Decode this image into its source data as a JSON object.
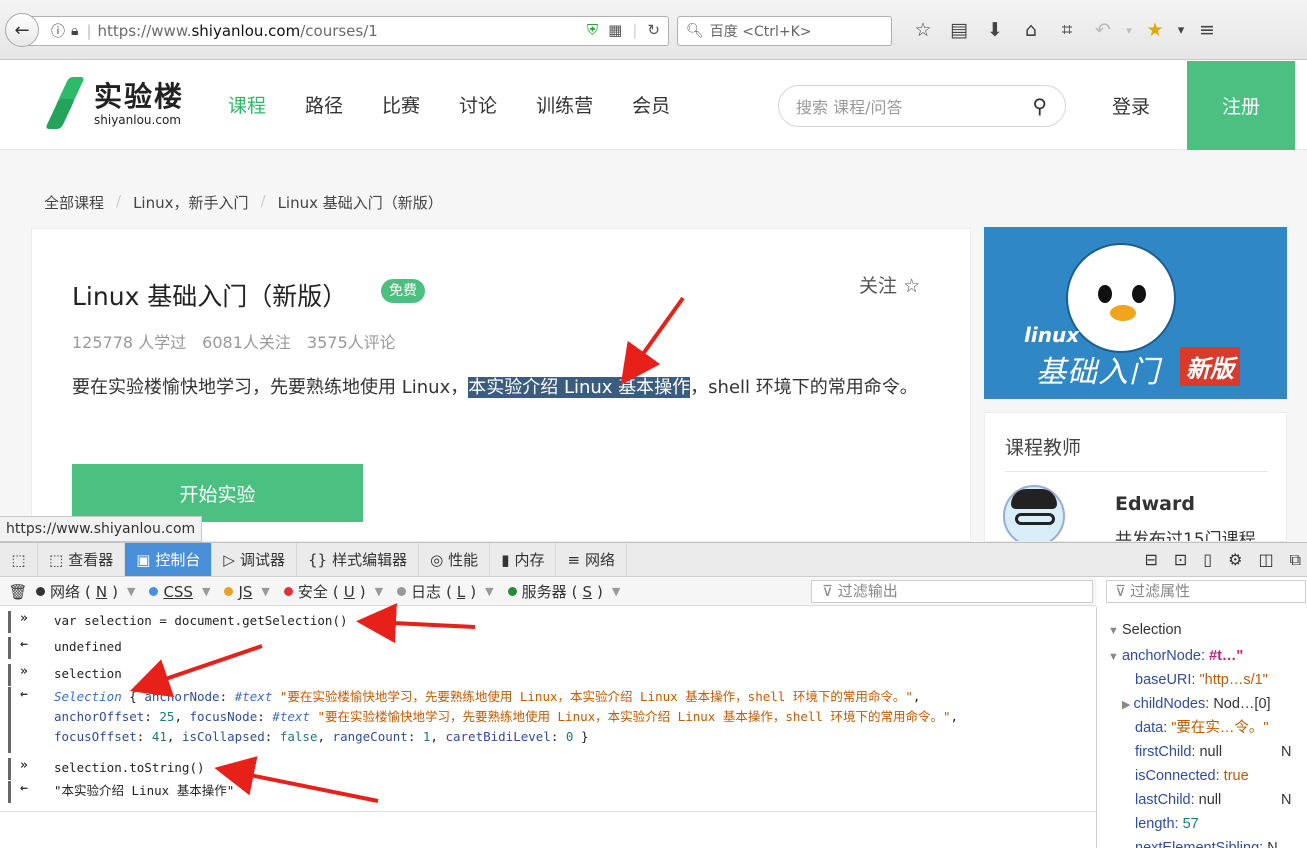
{
  "browser": {
    "url_scheme": "https://www.",
    "url_host": "shiyanlou.com",
    "url_path": "/courses/1",
    "search_placeholder": "百度 <Ctrl+K>"
  },
  "site": {
    "logo_cn": "实验楼",
    "logo_en": "shiyanlou.com",
    "nav": [
      "课程",
      "路径",
      "比赛",
      "讨论",
      "训练营",
      "会员"
    ],
    "search_placeholder": "搜索 课程/问答",
    "login": "登录",
    "register": "注册"
  },
  "breadcrumb": [
    "全部课程",
    "Linux，新手入门",
    "Linux 基础入门（新版）"
  ],
  "course": {
    "title": "Linux 基础入门（新版）",
    "badge": "免费",
    "follow": "关注",
    "stats": [
      "125778 人学过",
      "6081人关注",
      "3575人评论"
    ],
    "desc_before": "要在实验楼愉快地学习，先要熟练地使用 Linux，",
    "desc_selected": "本实验介绍 Linux 基本操作",
    "desc_after": "，shell 环境下的常用命令。",
    "start": "开始实验"
  },
  "banner": {
    "linux": "linux",
    "cn": "基础入门",
    "new": "新版"
  },
  "teacher": {
    "heading": "课程教师",
    "name": "Edward",
    "sub": "共发布过15门课程"
  },
  "status_url": "https://www.shiyanlou.com",
  "devtools": {
    "tabs": [
      "查看器",
      "控制台",
      "调试器",
      "样式编辑器",
      "性能",
      "内存",
      "网络"
    ],
    "filters": [
      {
        "label": "网络",
        "key": "N",
        "color": "#333333"
      },
      {
        "label": "CSS",
        "key": "",
        "color": "#4a90d9"
      },
      {
        "label": "JS",
        "key": "",
        "color": "#f0a020"
      },
      {
        "label": "安全",
        "key": "U",
        "color": "#e0303a"
      },
      {
        "label": "日志",
        "key": "L",
        "color": "#999999"
      },
      {
        "label": "服务器",
        "key": "S",
        "color": "#2a8a3a"
      }
    ],
    "filter_output": "过滤输出",
    "filter_props": "过滤属性"
  },
  "console": {
    "l1": "var selection = document.getSelection()",
    "l2": "undefined",
    "l3": "selection",
    "sel_obj_name": "Selection",
    "sel_text": "\"要在实验楼愉快地学习，先要熟练地使用 Linux，本实验介绍 Linux 基本操作，shell 环境下的常用命令。\"",
    "anchorOffset": "25",
    "focusOffset": "41",
    "isCollapsed": "false",
    "rangeCount": "1",
    "caretBidiLevel": "0",
    "l5": "selection.toString()",
    "l6": "\"本实验介绍 Linux 基本操作\""
  },
  "props": {
    "root": "Selection",
    "anchorNode_key": "anchorNode:",
    "anchorNode_val": "#t…\"",
    "baseURI_key": "baseURI:",
    "baseURI_val": "\"http…s/1\"",
    "childNodes_key": "childNodes:",
    "childNodes_val": "Nod…[0]",
    "data_key": "data:",
    "data_val": "\"要在实…令。\"",
    "firstChild_key": "firstChild:",
    "firstChild_val": "null",
    "isConnected_key": "isConnected:",
    "isConnected_val": "true",
    "lastChild_key": "lastChild:",
    "lastChild_val": "null",
    "length_key": "length:",
    "length_val": "57",
    "nextElementSibling_key": "nextElementSibling:",
    "nextElementSibling_val": "N",
    "trailing_n": "N"
  }
}
